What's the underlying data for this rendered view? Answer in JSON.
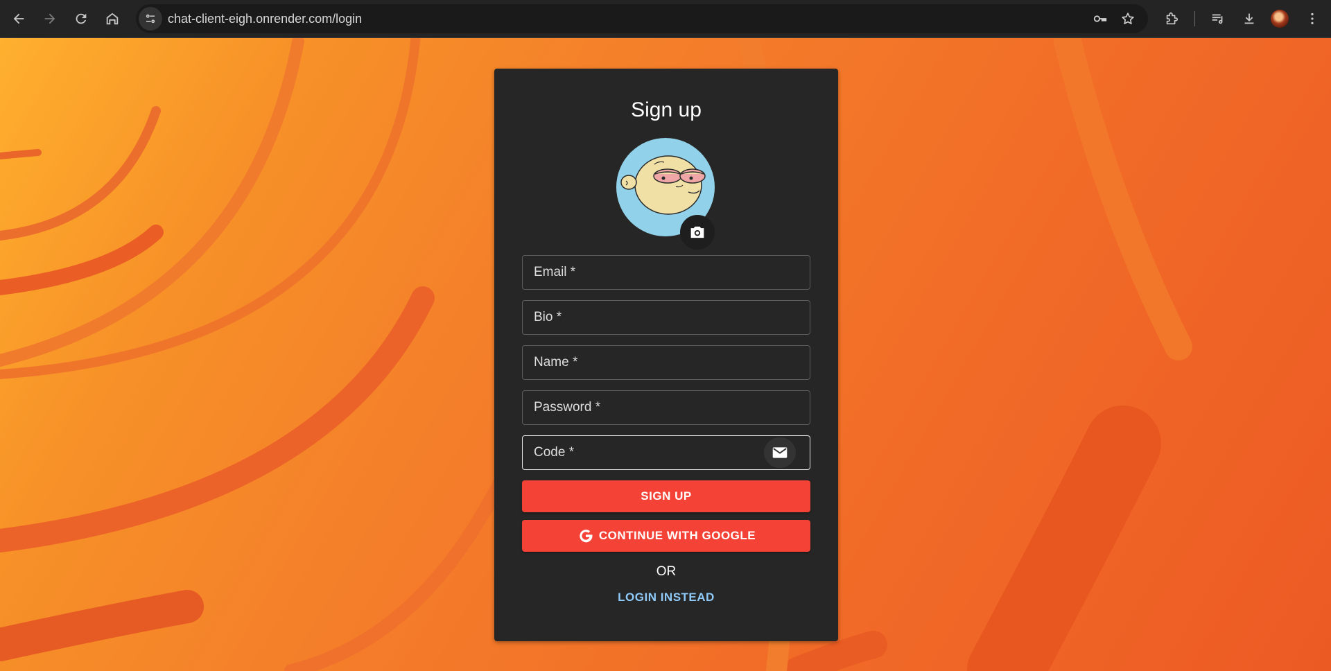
{
  "browser": {
    "url": "chat-client-eigh.onrender.com/login",
    "nav_icons": [
      "back-arrow-icon",
      "forward-arrow-icon",
      "reload-icon",
      "home-icon"
    ],
    "omnibox_icons": [
      "site-info-icon",
      "password-key-icon",
      "bookmark-star-icon"
    ],
    "toolbar_icons": [
      "extensions-puzzle-icon",
      "reading-list-icon",
      "download-icon",
      "profile-avatar",
      "kebab-menu-icon"
    ]
  },
  "form": {
    "title": "Sign up",
    "avatar_icon": "cartoon-avatar",
    "camera_icon": "camera-icon",
    "fields": {
      "email": {
        "label": "Email *"
      },
      "bio": {
        "label": "Bio *"
      },
      "name": {
        "label": "Name *"
      },
      "password": {
        "label": "Password *"
      },
      "code": {
        "label": "Code *",
        "focused": true,
        "action_icon": "mail-icon"
      }
    },
    "signup_button": "SIGN UP",
    "google_button": "CONTINUE WITH GOOGLE",
    "google_icon": "google-g-icon",
    "separator": "OR",
    "login_link": "LOGIN INSTEAD"
  },
  "colors": {
    "card_bg": "#262626",
    "primary_button": "#f44336",
    "link": "#8fcaf9",
    "background_orange": "#f47e2a",
    "avatar_bg": "#91d2ea"
  }
}
